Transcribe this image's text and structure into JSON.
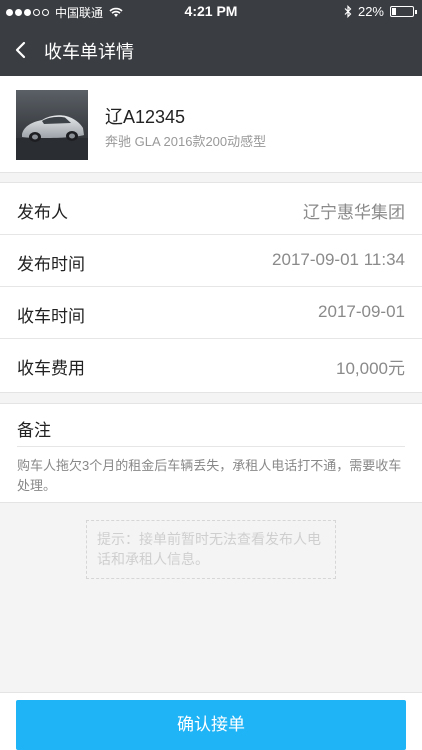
{
  "status_bar": {
    "carrier": "中国联通",
    "time": "4:21 PM",
    "battery_percent": "22%",
    "battery_level": 0.22
  },
  "nav": {
    "title": "收车单详情",
    "back_icon": "chevron-left-icon"
  },
  "car": {
    "plate": "辽A12345",
    "model": "奔驰 GLA 2016款200动感型"
  },
  "info": [
    {
      "label": "发布人",
      "value": "辽宁惠华集团"
    },
    {
      "label": "发布时间",
      "value": "2017-09-01 11:34"
    },
    {
      "label": "收车时间",
      "value": "2017-09-01"
    },
    {
      "label": "收车费用",
      "value": "10,000元"
    }
  ],
  "remark": {
    "title": "备注",
    "text": "购车人拖欠3个月的租金后车辆丢失，承租人电话打不通，需要收车处理。"
  },
  "tip": "提示：接单前暂时无法查看发布人电话和承租人信息。",
  "confirm_button": "确认接单",
  "colors": {
    "header_bg": "#3a3d42",
    "accent": "#1fb4f6"
  }
}
